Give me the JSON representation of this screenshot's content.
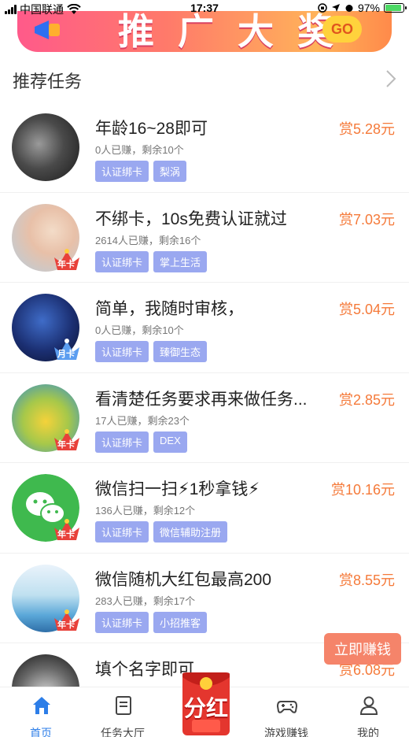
{
  "status_bar": {
    "carrier": "中国联通",
    "time": "17:37",
    "battery": "97%"
  },
  "banner": {
    "text": "推广大奖",
    "go": "GO"
  },
  "section": {
    "title": "推荐任务"
  },
  "tasks": [
    {
      "title": "年龄16~28即可",
      "stats": "0人已赚，剩余10个",
      "tags": [
        "认证绑卡",
        "梨涡"
      ],
      "reward": "赏5.28元",
      "badge": ""
    },
    {
      "title": "不绑卡，10s免费认证就过",
      "stats": "2614人已赚，剩余16个",
      "tags": [
        "认证绑卡",
        "掌上生活"
      ],
      "reward": "赏7.03元",
      "badge": "年卡"
    },
    {
      "title": "简单，我随时审核，",
      "stats": "0人已赚，剩余10个",
      "tags": [
        "认证绑卡",
        "臻御生态"
      ],
      "reward": "赏5.04元",
      "badge": "月卡"
    },
    {
      "title": "看清楚任务要求再来做任务...",
      "stats": "17人已赚，剩余23个",
      "tags": [
        "认证绑卡",
        "DEX"
      ],
      "reward": "赏2.85元",
      "badge": "年卡"
    },
    {
      "title": "微信扫一扫⚡1秒拿钱⚡",
      "stats": "136人已赚，剩余12个",
      "tags": [
        "认证绑卡",
        "微信辅助注册"
      ],
      "reward": "赏10.16元",
      "badge": "年卡"
    },
    {
      "title": "微信随机大红包最高200",
      "stats": "283人已赚，剩余17个",
      "tags": [
        "认证绑卡",
        "小招推客"
      ],
      "reward": "赏8.55元",
      "badge": "年卡"
    },
    {
      "title": "填个名字即可",
      "stats": "",
      "tags": [],
      "reward": "赏6.08元",
      "badge": ""
    }
  ],
  "floating": {
    "earn": "立即赚钱"
  },
  "tab_bar": {
    "items": [
      {
        "label": "首页",
        "icon": "home-icon"
      },
      {
        "label": "任务大厅",
        "icon": "task-hall-icon"
      },
      {
        "label": "分红",
        "icon": "red-packet-icon"
      },
      {
        "label": "游戏赚钱",
        "icon": "gamepad-icon"
      },
      {
        "label": "我的",
        "icon": "user-icon"
      }
    ]
  },
  "colors": {
    "accent": "#2d7ee8",
    "reward": "#f57a3a",
    "tag": "#9aa8f0",
    "earn_button": "#f5846a"
  }
}
